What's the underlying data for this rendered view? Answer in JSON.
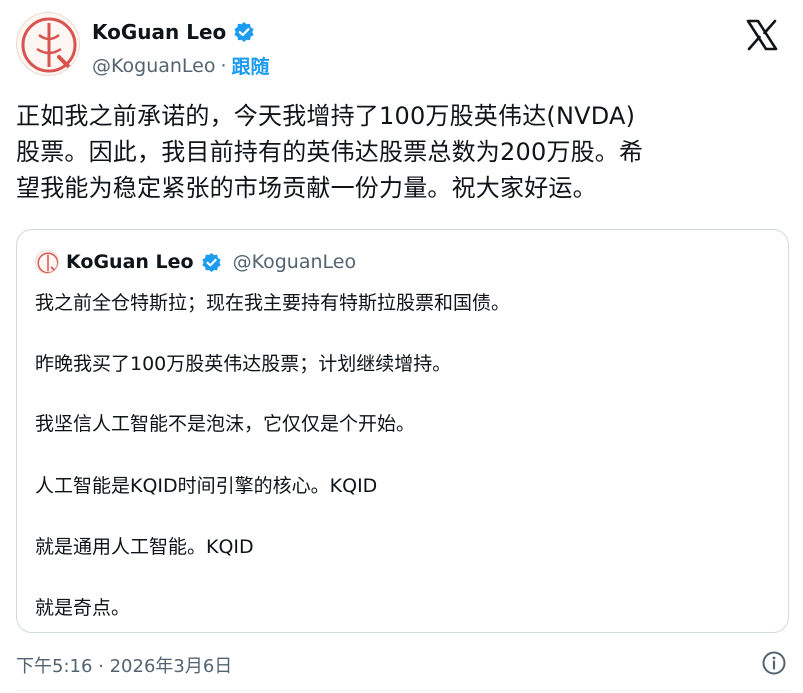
{
  "author": {
    "display_name": "KoGuan Leo",
    "handle": "@KoguanLeo",
    "separator": "·",
    "follow_label": "跟随"
  },
  "tweet": {
    "lines": [
      "正如我之前承诺的，今天我增持了100万股英伟达(NVDA)",
      "股票。因此，我目前持有的英伟达股票总数为200万股。希",
      "望我能为稳定紧张的市场贡献一份力量。祝大家好运。"
    ]
  },
  "quote": {
    "display_name": "KoGuan Leo",
    "handle": "@KoguanLeo",
    "lines": [
      "我之前全仓特斯拉；现在我主要持有特斯拉股票和国债。",
      "昨晚我买了100万股英伟达股票；计划继续增持。",
      "我坚信人工智能不是泡沫，它仅仅是个开始。",
      "人工智能是KQID时间引擎的核心。KQID",
      "就是通用人工智能。KQID",
      "就是奇点。"
    ]
  },
  "footer": {
    "timestamp": "下午5:16 · 2026年3月6日"
  },
  "icons": {
    "verified": "verified-badge-icon",
    "x_logo": "x-logo-icon",
    "info": "info-icon"
  },
  "colors": {
    "accent": "#1d9bf0",
    "text_primary": "#0f1419",
    "text_secondary": "#536471",
    "border": "#cfd9de"
  }
}
